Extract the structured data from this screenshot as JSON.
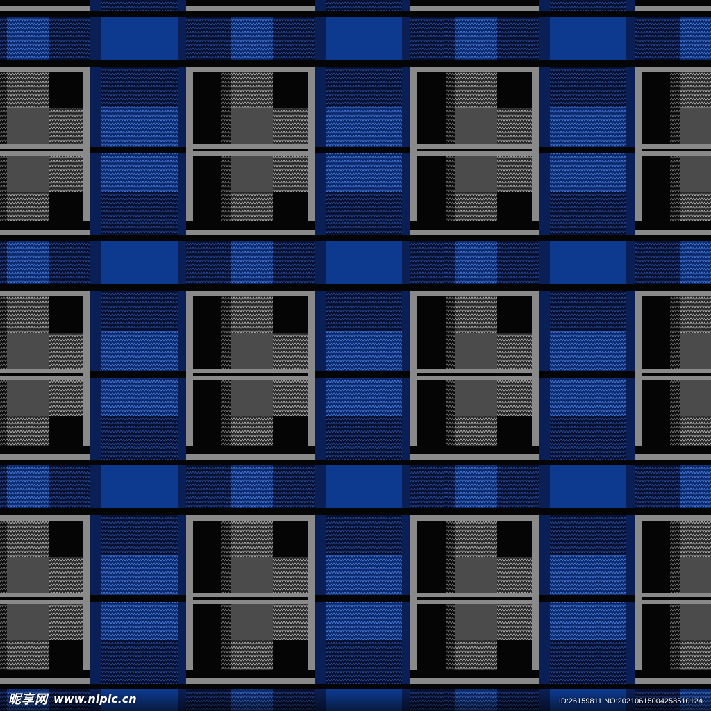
{
  "pattern": {
    "name": "blue-black-gray-plaid",
    "colors": {
      "black": "#050505",
      "dark_gray": "#4a4a4a",
      "mid_gray": "#7e7e7e",
      "light_gray": "#9a9a9a",
      "royal_blue": "#0d3a8e",
      "navy": "#0a1f55",
      "herringbone_line": "#cfcfcf",
      "herringbone_blue_line": "#5a86e0"
    }
  },
  "watermark": {
    "logo_text": "昵享网",
    "url_text": "www.nipic.cn",
    "id_text": "ID:26159811 NO:20210615004258510124"
  }
}
